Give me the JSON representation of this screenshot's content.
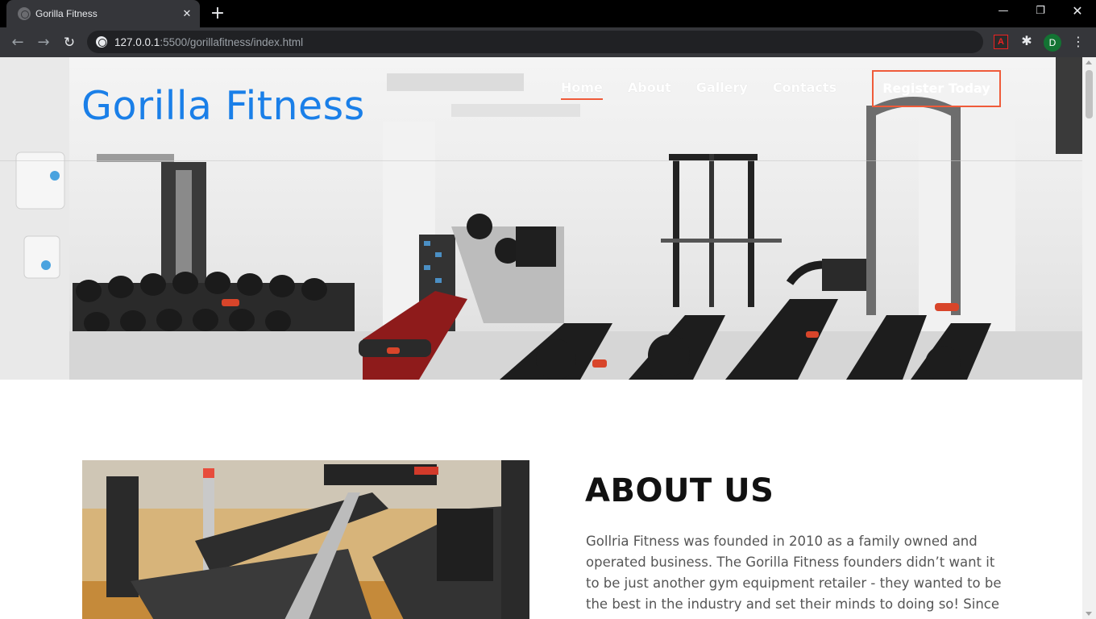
{
  "browser": {
    "tab_title": "Gorilla Fitness",
    "tab_close": "✕",
    "new_tab": "+",
    "window": {
      "minimize": "—",
      "maximize": "❐",
      "close": "✕"
    },
    "nav": {
      "back": "←",
      "forward": "→",
      "reload": "↻"
    },
    "url_host": "127.0.0.1",
    "url_path": ":5500/gorillafitness/index.html",
    "extensions": {
      "pdf": "A",
      "puzzle": "✱",
      "menu": "⋮"
    },
    "profile_initial": "D"
  },
  "site": {
    "logo": "Gorilla Fitness",
    "nav_items": [
      {
        "label": "Home",
        "active": true
      },
      {
        "label": "About",
        "active": false
      },
      {
        "label": "Gallery",
        "active": false
      },
      {
        "label": "Contacts",
        "active": false
      }
    ],
    "register_label": "Register Today",
    "accent_color": "#ef5b3a",
    "logo_color": "#1a7fe8"
  },
  "about": {
    "title": "ABOUT US",
    "text": "Gollria Fitness was founded in 2010 as a family owned and operated business. The Gorilla Fitness founders didn’t want it to be just another gym equipment retailer - they wanted to be the best in the industry and set their minds to doing so! Since its"
  }
}
